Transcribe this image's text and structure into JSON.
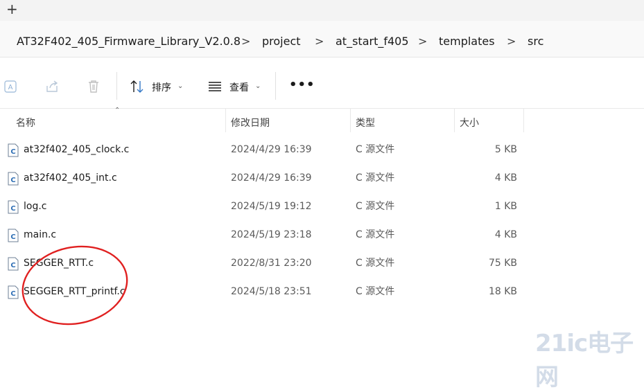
{
  "tabbar": {
    "new_tab_glyph": "+"
  },
  "breadcrumb": [
    "AT32F402_405_Firmware_Library_V2.0.8",
    "project",
    "at_start_f405",
    "templates",
    "src"
  ],
  "breadcrumb_separator": ">",
  "toolbar": {
    "sort_label": "排序",
    "view_label": "查看",
    "more_label": "•••",
    "icons": [
      "rename-icon",
      "share-icon",
      "delete-icon",
      "sort-icon",
      "view-icon"
    ]
  },
  "columns": {
    "name": "名称",
    "date": "修改日期",
    "type": "类型",
    "size": "大小"
  },
  "files": [
    {
      "name": "at32f402_405_clock.c",
      "date": "2024/4/29 16:39",
      "type": "C 源文件",
      "size": "5 KB"
    },
    {
      "name": "at32f402_405_int.c",
      "date": "2024/4/29 16:39",
      "type": "C 源文件",
      "size": "4 KB"
    },
    {
      "name": "log.c",
      "date": "2024/5/19 19:12",
      "type": "C 源文件",
      "size": "1 KB"
    },
    {
      "name": "main.c",
      "date": "2024/5/19 23:18",
      "type": "C 源文件",
      "size": "4 KB"
    },
    {
      "name": "SEGGER_RTT.c",
      "date": "2022/8/31 23:20",
      "type": "C 源文件",
      "size": "75 KB"
    },
    {
      "name": "SEGGER_RTT_printf.c",
      "date": "2024/5/18 23:51",
      "type": "C 源文件",
      "size": "18 KB"
    }
  ],
  "annotation_color": "#e02020",
  "watermark": "21ic电子网"
}
